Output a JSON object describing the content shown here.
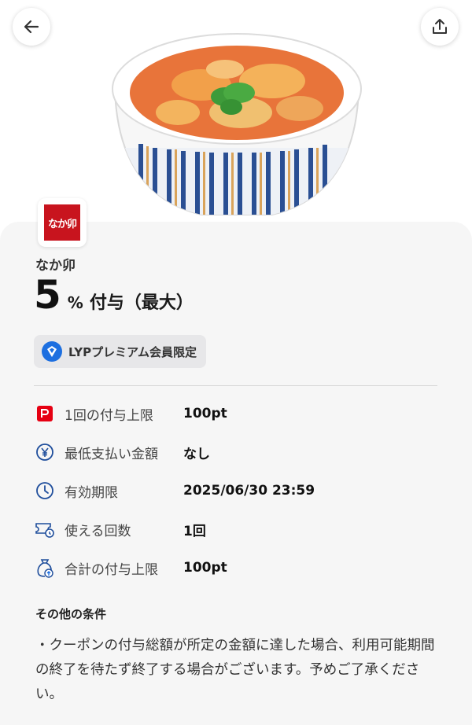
{
  "hero": {
    "image_desc_icon": "oyakodon-bowl-image"
  },
  "header": {
    "back_icon": "arrow-left-icon",
    "share_icon": "share-icon"
  },
  "store": {
    "logo_text": "なか卯",
    "name": "なか卯"
  },
  "reward": {
    "rate": "5",
    "unit": "%",
    "text": "付与（最大）"
  },
  "badge": {
    "label": "LYPプレミアム会員限定"
  },
  "details": [
    {
      "label": "1回の付与上限",
      "value": "100pt"
    },
    {
      "label": "最低支払い金額",
      "value": "なし"
    },
    {
      "label": "有効期限",
      "value": "2025/06/30 23:59"
    },
    {
      "label": "使える回数",
      "value": "1回"
    },
    {
      "label": "合計の付与上限",
      "value": "100pt"
    }
  ],
  "conditions": {
    "title": "その他の条件",
    "text": "・クーポンの付与総額が所定の金額に達した場合、利用可能期間の終了を待たず終了する場合がございます。予めご了承ください。"
  },
  "colors": {
    "paypay_red": "#e60012",
    "icon_blue": "#1f4e9c",
    "badge_bg": "#e7e7e9"
  }
}
